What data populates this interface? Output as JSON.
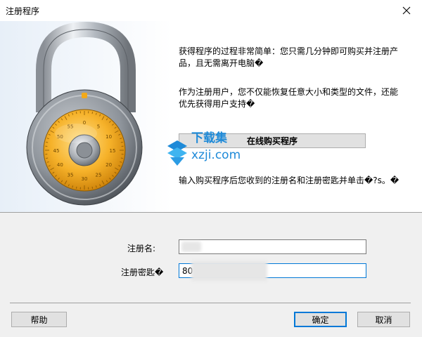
{
  "window": {
    "title": "注册程序",
    "close_icon": "close-icon"
  },
  "info": {
    "para1": "获得程序的过程非常简单：您只需几分钟即可购买并注册产品，且无需离开电脑�",
    "para2": "作为注册用户，您不仅能恢复任意大小和类型的文件，还能优先获得用户支持�",
    "buy_button": "在线购买程序",
    "para3": "输入购买程序后您收到的注册名和注册密匙并单击�?s。�"
  },
  "watermark": {
    "brand": "下载集",
    "domain": "xzji.com"
  },
  "lock_dial": {
    "numbers": [
      "0",
      "5",
      "10",
      "15",
      "20",
      "25",
      "30",
      "35",
      "40",
      "45",
      "50",
      "55"
    ]
  },
  "form": {
    "name_label": "注册名:",
    "name_value": "",
    "key_label": "注册密匙�",
    "key_value": "80"
  },
  "buttons": {
    "help": "帮助",
    "ok": "确定",
    "cancel": "取消"
  },
  "colors": {
    "accent": "#0078d7",
    "dial_orange": "#f2a91a",
    "watermark_blue": "#1e8ad8"
  }
}
